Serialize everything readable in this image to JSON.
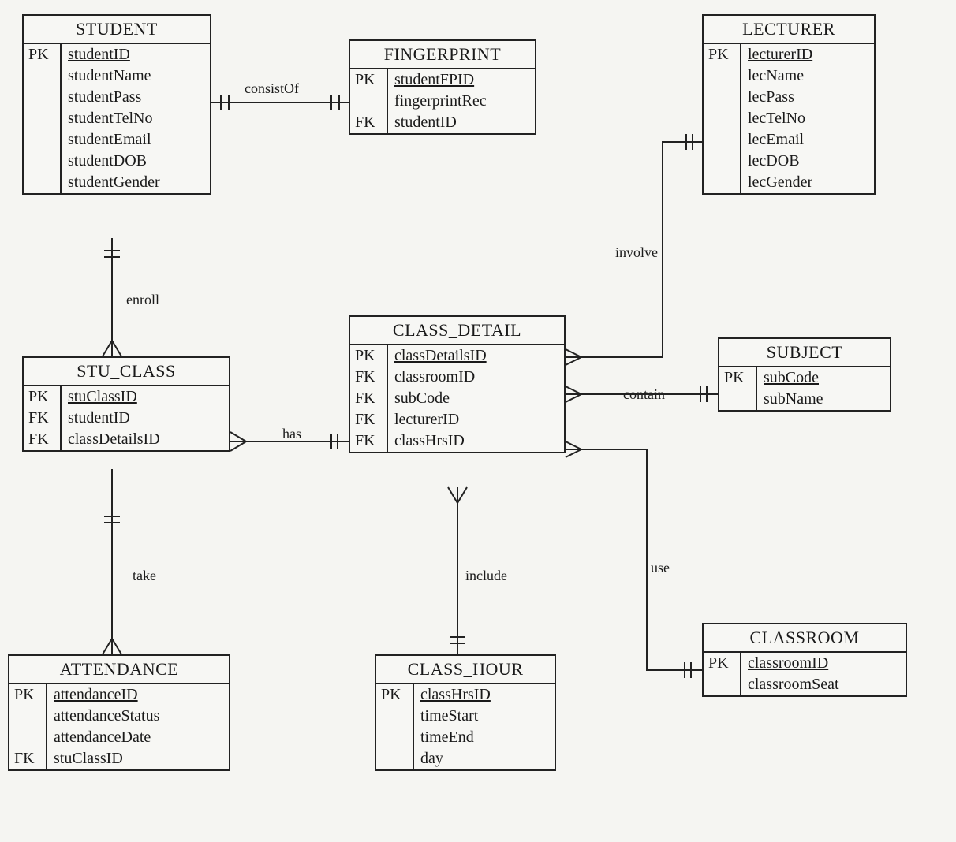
{
  "entities": {
    "student": {
      "title": "STUDENT",
      "attrs": [
        {
          "key": "PK",
          "name": "studentID",
          "pk": true
        },
        {
          "key": "",
          "name": "studentName"
        },
        {
          "key": "",
          "name": "studentPass"
        },
        {
          "key": "",
          "name": "studentTelNo"
        },
        {
          "key": "",
          "name": "studentEmail"
        },
        {
          "key": "",
          "name": "studentDOB"
        },
        {
          "key": "",
          "name": "studentGender"
        }
      ]
    },
    "fingerprint": {
      "title": "FINGERPRINT",
      "attrs": [
        {
          "key": "PK",
          "name": "studentFPID",
          "pk": true
        },
        {
          "key": "",
          "name": "fingerprintRec"
        },
        {
          "key": "FK",
          "name": "studentID"
        }
      ]
    },
    "lecturer": {
      "title": "LECTURER",
      "attrs": [
        {
          "key": "PK",
          "name": "lecturerID",
          "pk": true
        },
        {
          "key": "",
          "name": "lecName"
        },
        {
          "key": "",
          "name": "lecPass"
        },
        {
          "key": "",
          "name": "lecTelNo"
        },
        {
          "key": "",
          "name": "lecEmail"
        },
        {
          "key": "",
          "name": "lecDOB"
        },
        {
          "key": "",
          "name": "lecGender"
        }
      ]
    },
    "stu_class": {
      "title": "STU_CLASS",
      "attrs": [
        {
          "key": "PK",
          "name": "stuClassID",
          "pk": true
        },
        {
          "key": "FK",
          "name": "studentID"
        },
        {
          "key": "FK",
          "name": "classDetailsID"
        }
      ]
    },
    "class_detail": {
      "title": "CLASS_DETAIL",
      "attrs": [
        {
          "key": "PK",
          "name": "classDetailsID",
          "pk": true
        },
        {
          "key": "FK",
          "name": "classroomID"
        },
        {
          "key": "FK",
          "name": "subCode"
        },
        {
          "key": "FK",
          "name": "lecturerID"
        },
        {
          "key": "FK",
          "name": "classHrsID"
        }
      ]
    },
    "subject": {
      "title": "SUBJECT",
      "attrs": [
        {
          "key": "PK",
          "name": "subCode",
          "pk": true
        },
        {
          "key": "",
          "name": "subName"
        }
      ]
    },
    "attendance": {
      "title": "ATTENDANCE",
      "attrs": [
        {
          "key": "PK",
          "name": "attendanceID",
          "pk": true
        },
        {
          "key": "",
          "name": "attendanceStatus"
        },
        {
          "key": "",
          "name": "attendanceDate"
        },
        {
          "key": "FK",
          "name": "stuClassID"
        }
      ]
    },
    "class_hour": {
      "title": "CLASS_HOUR",
      "attrs": [
        {
          "key": "PK",
          "name": "classHrsID",
          "pk": true
        },
        {
          "key": "",
          "name": "timeStart"
        },
        {
          "key": "",
          "name": "timeEnd"
        },
        {
          "key": "",
          "name": "day"
        }
      ]
    },
    "classroom": {
      "title": "CLASSROOM",
      "attrs": [
        {
          "key": "PK",
          "name": "classroomID",
          "pk": true
        },
        {
          "key": "",
          "name": "classroomSeat"
        }
      ]
    }
  },
  "relationships": {
    "consistOf": "consistOf",
    "enroll": "enroll",
    "has": "has",
    "take": "take",
    "involve": "involve",
    "contain": "contain",
    "use": "use",
    "include": "include"
  }
}
